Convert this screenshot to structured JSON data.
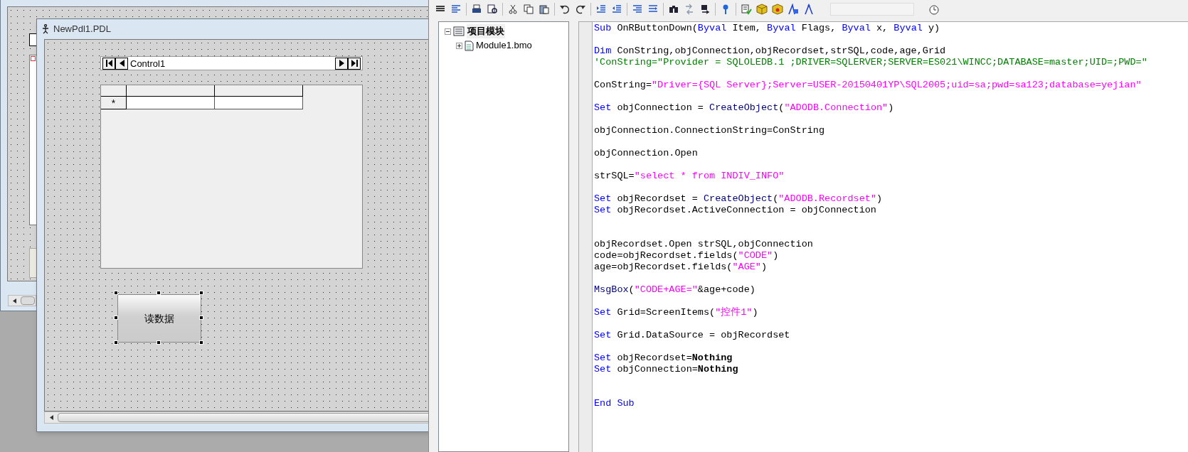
{
  "designer": {
    "window": {
      "title": "NewPdl1.PDL"
    },
    "navigator": {
      "label": "Control1"
    },
    "table": {
      "new_row_marker": "*"
    },
    "button": {
      "label": "读数据",
      "selected": true
    }
  },
  "editor": {
    "tree": [
      {
        "label": "项目模块",
        "expanded": true,
        "children": [
          {
            "label": "Module1.bmo",
            "expanded": false
          }
        ]
      }
    ],
    "code_lines": [
      {
        "kind": "code",
        "segments": [
          {
            "kind": "keyword",
            "text": "Sub"
          },
          {
            "kind": "plain",
            "text": " OnRButtonDown("
          },
          {
            "kind": "keyword",
            "text": "Byval"
          },
          {
            "kind": "plain",
            "text": " Item, "
          },
          {
            "kind": "keyword",
            "text": "Byval"
          },
          {
            "kind": "plain",
            "text": " Flags, "
          },
          {
            "kind": "keyword",
            "text": "Byval"
          },
          {
            "kind": "plain",
            "text": " x, "
          },
          {
            "kind": "keyword",
            "text": "Byval"
          },
          {
            "kind": "plain",
            "text": " y)"
          }
        ]
      },
      {
        "kind": "blank"
      },
      {
        "kind": "code",
        "segments": [
          {
            "kind": "keyword",
            "text": "Dim"
          },
          {
            "kind": "plain",
            "text": " ConString,objConnection,objRecordset,strSQL,code,age,Grid"
          }
        ]
      },
      {
        "kind": "code",
        "segments": [
          {
            "kind": "comment",
            "text": "'ConString=\"Provider = SQLOLEDB.1 ;DRIVER=SQLERVER;SERVER=ES021\\WINCC;DATABASE=master;UID=;PWD=\""
          }
        ]
      },
      {
        "kind": "blank"
      },
      {
        "kind": "code",
        "segments": [
          {
            "kind": "plain",
            "text": "ConString="
          },
          {
            "kind": "string",
            "text": "\"Driver={SQL Server};Server=USER-20150401YP\\SQL2005;uid=sa;pwd=sa123;database=yejian\""
          }
        ]
      },
      {
        "kind": "blank"
      },
      {
        "kind": "code",
        "segments": [
          {
            "kind": "keyword",
            "text": "Set"
          },
          {
            "kind": "plain",
            "text": " objConnection = "
          },
          {
            "kind": "function",
            "text": "CreateObject"
          },
          {
            "kind": "plain",
            "text": "("
          },
          {
            "kind": "string",
            "text": "\"ADODB.Connection\""
          },
          {
            "kind": "plain",
            "text": ")"
          }
        ]
      },
      {
        "kind": "blank"
      },
      {
        "kind": "code",
        "segments": [
          {
            "kind": "plain",
            "text": "objConnection.ConnectionString=ConString"
          }
        ]
      },
      {
        "kind": "blank"
      },
      {
        "kind": "code",
        "segments": [
          {
            "kind": "plain",
            "text": "objConnection.Open"
          }
        ]
      },
      {
        "kind": "blank"
      },
      {
        "kind": "code",
        "segments": [
          {
            "kind": "plain",
            "text": "strSQL="
          },
          {
            "kind": "string",
            "text": "\"select * from INDIV_INFO\""
          }
        ]
      },
      {
        "kind": "blank"
      },
      {
        "kind": "code",
        "segments": [
          {
            "kind": "keyword",
            "text": "Set"
          },
          {
            "kind": "plain",
            "text": " objRecordset = "
          },
          {
            "kind": "function",
            "text": "CreateObject"
          },
          {
            "kind": "plain",
            "text": "("
          },
          {
            "kind": "string",
            "text": "\"ADODB.Recordset\""
          },
          {
            "kind": "plain",
            "text": ")"
          }
        ]
      },
      {
        "kind": "code",
        "segments": [
          {
            "kind": "keyword",
            "text": "Set"
          },
          {
            "kind": "plain",
            "text": " objRecordset.ActiveConnection = objConnection"
          }
        ]
      },
      {
        "kind": "blank"
      },
      {
        "kind": "blank"
      },
      {
        "kind": "code",
        "segments": [
          {
            "kind": "plain",
            "text": "objRecordset.Open strSQL,objConnection"
          }
        ]
      },
      {
        "kind": "code",
        "segments": [
          {
            "kind": "plain",
            "text": "code=objRecordset.fields("
          },
          {
            "kind": "string",
            "text": "\"CODE\""
          },
          {
            "kind": "plain",
            "text": ")"
          }
        ]
      },
      {
        "kind": "code",
        "segments": [
          {
            "kind": "plain",
            "text": "age=objRecordset.fields("
          },
          {
            "kind": "string",
            "text": "\"AGE\""
          },
          {
            "kind": "plain",
            "text": ")"
          }
        ]
      },
      {
        "kind": "blank"
      },
      {
        "kind": "code",
        "segments": [
          {
            "kind": "function",
            "text": "MsgBox"
          },
          {
            "kind": "plain",
            "text": "("
          },
          {
            "kind": "string",
            "text": "\"CODE+AGE=\""
          },
          {
            "kind": "plain",
            "text": "&age+code)"
          }
        ]
      },
      {
        "kind": "blank"
      },
      {
        "kind": "code",
        "segments": [
          {
            "kind": "keyword",
            "text": "Set"
          },
          {
            "kind": "plain",
            "text": " Grid=ScreenItems("
          },
          {
            "kind": "string",
            "text": "\"控件1\""
          },
          {
            "kind": "plain",
            "text": ")"
          }
        ]
      },
      {
        "kind": "blank"
      },
      {
        "kind": "code",
        "segments": [
          {
            "kind": "keyword",
            "text": "Set"
          },
          {
            "kind": "plain",
            "text": " Grid.DataSource = objRecordset"
          }
        ]
      },
      {
        "kind": "blank"
      },
      {
        "kind": "code",
        "segments": [
          {
            "kind": "keyword",
            "text": "Set"
          },
          {
            "kind": "plain",
            "text": " objRecordset="
          },
          {
            "kind": "bold",
            "text": "Nothing"
          }
        ]
      },
      {
        "kind": "code",
        "segments": [
          {
            "kind": "keyword",
            "text": "Set"
          },
          {
            "kind": "plain",
            "text": " objConnection="
          },
          {
            "kind": "bold",
            "text": "Nothing"
          }
        ]
      },
      {
        "kind": "blank"
      },
      {
        "kind": "blank"
      },
      {
        "kind": "code",
        "segments": [
          {
            "kind": "keyword",
            "text": "End Sub"
          }
        ]
      }
    ]
  }
}
